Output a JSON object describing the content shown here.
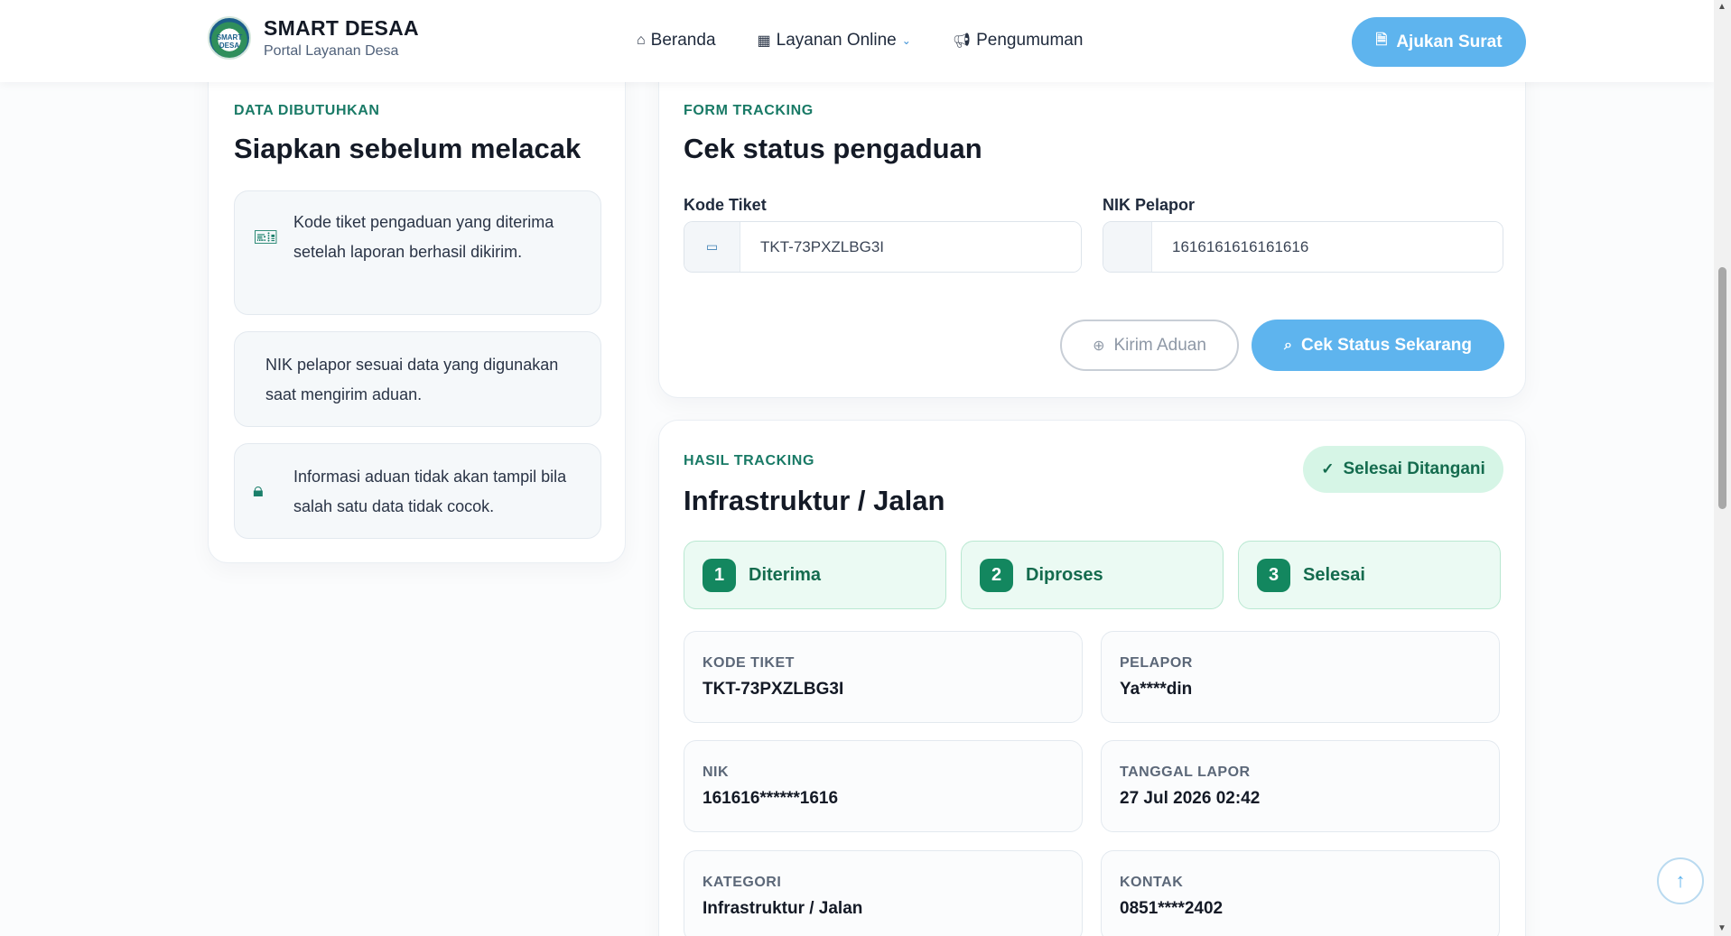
{
  "header": {
    "brand_title": "SMART DESAA",
    "brand_subtitle": "Portal Layanan Desa",
    "logo_text": "SMART DESA",
    "nav": [
      {
        "label": "Beranda",
        "icon": "home-icon"
      },
      {
        "label": "Layanan Online",
        "icon": "grid-icon"
      },
      {
        "label": "Pengumuman",
        "icon": "megaphone-icon"
      }
    ],
    "cta_label": "Ajukan Surat"
  },
  "prep": {
    "eyebrow": "DATA DIBUTUHKAN",
    "title": "Siapkan sebelum melacak",
    "items": [
      {
        "text": "Kode tiket pengaduan yang diterima setelah laporan berhasil dikirim.",
        "icon": "ticket-icon"
      },
      {
        "text": "NIK pelapor sesuai data yang digunakan saat mengirim aduan.",
        "icon": ""
      },
      {
        "text": "Informasi aduan tidak akan tampil bila salah satu data tidak cocok.",
        "icon": "lock-icon"
      }
    ]
  },
  "form": {
    "eyebrow": "FORM TRACKING",
    "title": "Cek status pengaduan",
    "ticket_label": "Kode Tiket",
    "ticket_value": "TKT-73PXZLBG3I",
    "nik_label": "NIK Pelapor",
    "nik_value": "1616161616161616",
    "btn_secondary": "Kirim Aduan",
    "btn_primary": "Cek Status Sekarang"
  },
  "result": {
    "eyebrow": "HASIL TRACKING",
    "title": "Infrastruktur / Jalan",
    "status": "Selesai Ditangani",
    "steps": [
      {
        "num": "1",
        "label": "Diterima"
      },
      {
        "num": "2",
        "label": "Diproses"
      },
      {
        "num": "3",
        "label": "Selesai"
      }
    ],
    "details": [
      {
        "label": "KODE TIKET",
        "value": "TKT-73PXZLBG3I"
      },
      {
        "label": "PELAPOR",
        "value": "Ya****din"
      },
      {
        "label": "NIK",
        "value": "161616******1616"
      },
      {
        "label": "TANGGAL LAPOR",
        "value": "27 Jul 2026 02:42"
      },
      {
        "label": "KATEGORI",
        "value": "Infrastruktur / Jalan"
      },
      {
        "label": "KONTAK",
        "value": "0851****2402"
      }
    ]
  },
  "colors": {
    "accent": "#5eb4ee",
    "brand_green": "#197a66",
    "success_bg": "#d6f5e6"
  }
}
